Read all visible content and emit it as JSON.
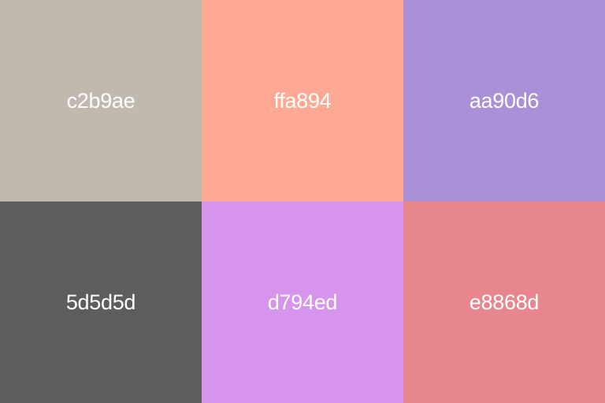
{
  "palette": {
    "swatches": [
      {
        "label": "c2b9ae",
        "color": "#c2b9ae"
      },
      {
        "label": "ffa894",
        "color": "#ffa894"
      },
      {
        "label": "aa90d6",
        "color": "#aa90d6"
      },
      {
        "label": "5d5d5d",
        "color": "#5d5d5d"
      },
      {
        "label": "d794ed",
        "color": "#d794ed"
      },
      {
        "label": "e8868d",
        "color": "#e8868d"
      }
    ],
    "label_color": "#ffffff"
  }
}
